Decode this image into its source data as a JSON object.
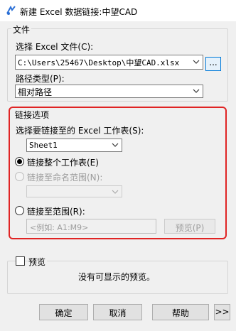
{
  "window": {
    "title": "新建 Excel 数据链接:中望CAD"
  },
  "file_group": {
    "legend": "文件",
    "choose_file_label": "选择 Excel 文件(C):",
    "file_path": "C:\\Users\\25467\\Desktop\\中望CAD.xlsx",
    "browse_label": "...",
    "path_type_label": "路径类型(P):",
    "path_type_value": "相对路径"
  },
  "link_options": {
    "legend": "链接选项",
    "choose_sheet_label": "选择要链接至的 Excel 工作表(S):",
    "sheet_value": "Sheet1",
    "link_whole_sheet_label": "链接整个工作表(E)",
    "link_named_range_label": "链接至命名范围(N):",
    "link_range_label": "链接至范围(R):",
    "range_placeholder": "<例如: A1:M9>",
    "preview_button": "预览(P)"
  },
  "preview_group": {
    "checkbox_label": "预览",
    "empty_message": "没有可显示的预览。"
  },
  "footer": {
    "ok": "确定",
    "cancel": "取消",
    "help": "帮助",
    "more": ">>"
  }
}
